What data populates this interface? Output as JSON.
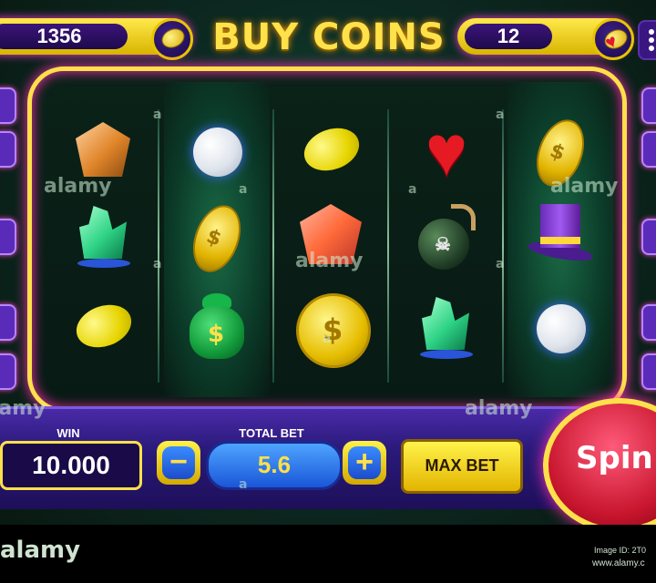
{
  "header": {
    "coins": "1356",
    "title": "BUY COINS",
    "lives": "12",
    "coin_icon": "coin-icon",
    "heart_icon": "heart-icon",
    "menu_icon": "more-vertical-icon"
  },
  "reels": [
    [
      "orange-gem-icon",
      "green-crystal-icon",
      "lemon-icon"
    ],
    [
      "pearl-icon",
      "gold-coin-icon",
      "money-bag-icon"
    ],
    [
      "lemon-icon",
      "red-gem-icon",
      "big-gold-coin-icon"
    ],
    [
      "heart-icon",
      "bomb-icon",
      "green-crystal-icon"
    ],
    [
      "gold-coin-icon",
      "top-hat-icon",
      "pearl-icon"
    ]
  ],
  "controls": {
    "win_label": "WIN",
    "win_value": "10.000",
    "total_bet_label": "TOTAL BET",
    "bet_value": "5.6",
    "minus_label": "−",
    "plus_label": "+",
    "max_bet_label": "MAX BET",
    "spin_label": "Spin"
  },
  "footer": {
    "brand": "alamy",
    "image_id": "Image ID: 2T0",
    "site": "www.alamy.c"
  },
  "watermarks": {
    "text": "alamy",
    "small": "a"
  },
  "colors": {
    "frame": "#ffe04a",
    "glow": "#ff2fb0",
    "panel": "#2a1a7a",
    "spin": "#c8162e"
  }
}
